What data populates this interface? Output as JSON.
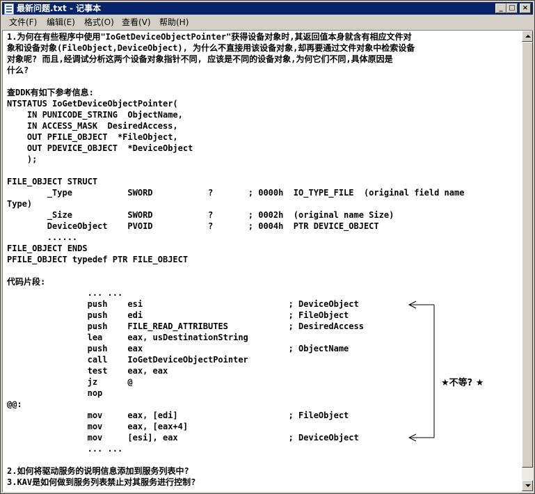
{
  "window": {
    "title": "最新问题.txt - 记事本",
    "buttons": {
      "minimize": "_",
      "maximize": "□",
      "close": "×"
    }
  },
  "menu": [
    "文件(F)",
    "编辑(E)",
    "格式(O)",
    "查看(V)",
    "帮助(H)"
  ],
  "document": {
    "lines": [
      "1.为何在有些程序中使用\"IoGetDeviceObjectPointer\"获得设备对象时,其返回值本身就含有相应文件对",
      "象和设备对象(FileObject,DeviceObject), 为什么不直接用该设备对象,却再要通过文件对象中检索设备",
      "对象呢? 而且,经调试分析这两个设备对象指针不同, 应该是不同的设备对象,为何它们不同,具体原因是",
      "什么?",
      "",
      "查DDK有如下参考信息:",
      "NTSTATUS IoGetDeviceObjectPointer(",
      "    IN PUNICODE_STRING  ObjectName,",
      "    IN ACCESS_MASK  DesiredAccess,",
      "    OUT PFILE_OBJECT  *FileObject,",
      "    OUT PDEVICE_OBJECT  *DeviceObject",
      "    );",
      "",
      "FILE_OBJECT STRUCT",
      "        _Type           SWORD           ?       ; 0000h  IO_TYPE_FILE  (original field name",
      "Type)",
      "        _Size           SWORD           ?       ; 0002h  (original name Size)",
      "        DeviceObject    PVOID           ?       ; 0004h  PTR DEVICE_OBJECT",
      "        ......",
      "FILE_OBJECT ENDS",
      "PFILE_OBJECT typedef PTR FILE_OBJECT",
      "",
      "代码片段:",
      "                ... ...",
      "                push    esi                             ; DeviceObject",
      "                push    edi                             ; FileObject",
      "                push    FILE_READ_ATTRIBUTES            ; DesiredAccess",
      "                lea     eax, usDestinationString",
      "                push    eax                             ; ObjectName",
      "                call    IoGetDeviceObjectPointer",
      "                test    eax, eax",
      "                jz      @",
      "                nop",
      "@@:",
      "                mov     eax, [edi]                      ; FileObject",
      "                mov     eax, [eax+4]",
      "                mov     [esi], eax                      ; DeviceObject",
      "                ... ...",
      "",
      "2.如何将驱动服务的说明信息添加到服务列表中?",
      "3.KAV是如何做到服务列表禁止对其服务进行控制?"
    ]
  },
  "annotation": {
    "note": "★不等? ★"
  }
}
